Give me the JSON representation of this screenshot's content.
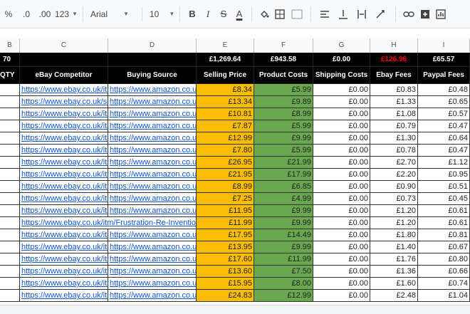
{
  "toolbar": {
    "percent": "%",
    "decrease_decimals": ".0",
    "increase_decimals": ".00",
    "format_more": "123",
    "font": "Arial",
    "font_size": "10",
    "bold": "B",
    "italic": "I",
    "strikethrough": "S",
    "text_color": "A"
  },
  "columns": [
    "B",
    "C",
    "D",
    "E",
    "F",
    "G",
    "H",
    "I"
  ],
  "totals": {
    "b": "70",
    "selling_price": "£1,269.64",
    "product_costs": "£943.58",
    "shipping_costs": "£0.00",
    "ebay_fees": "£126.96",
    "paypal_fees": "£65.57"
  },
  "headers": {
    "b": "QTY",
    "ebay_competitor": "eBay Competitor",
    "buying_source": "Buying Source",
    "selling_price": "Selling Price",
    "product_costs": "Product Costs",
    "shipping_costs": "Shipping Costs",
    "ebay_fees": "Ebay Fees",
    "paypal_fees": "Paypal Fees"
  },
  "colors": {
    "ebay_fees_total": "#ff0000",
    "selling_bg": "#fbbc04",
    "cost_bg": "#6aa84f"
  },
  "rows": [
    {
      "competitor": "https://www.ebay.co.uk/itm",
      "source": "https://www.amazon.co.uk",
      "price": "£8.34",
      "cost": "£5.99",
      "ship": "£0.00",
      "ebay": "£0.83",
      "paypal": "£0.48"
    },
    {
      "competitor": "https://www.ebay.co.uk/sch",
      "source": "https://www.amazon.co.uk",
      "price": "£13.34",
      "cost": "£9.89",
      "ship": "£0.00",
      "ebay": "£1.33",
      "paypal": "£0.65"
    },
    {
      "competitor": "https://www.ebay.co.uk/itm",
      "source": "https://www.amazon.co.uk",
      "price": "£10.81",
      "cost": "£8.99",
      "ship": "£0.00",
      "ebay": "£1.08",
      "paypal": "£0.57"
    },
    {
      "competitor": "https://www.ebay.co.uk/itm",
      "source": "https://www.amazon.co.uk",
      "price": "£7.87",
      "cost": "£5.99",
      "ship": "£0.00",
      "ebay": "£0.79",
      "paypal": "£0.47"
    },
    {
      "competitor": "https://www.ebay.co.uk/itm",
      "source": "https://www.amazon.co.uk",
      "price": "£12.99",
      "cost": "£9.99",
      "ship": "£0.00",
      "ebay": "£1.30",
      "paypal": "£0.64"
    },
    {
      "competitor": "https://www.ebay.co.uk/itm",
      "source": "https://www.amazon.co.uk",
      "price": "£7.80",
      "cost": "£5.99",
      "ship": "£0.00",
      "ebay": "£0.78",
      "paypal": "£0.47"
    },
    {
      "competitor": "https://www.ebay.co.uk/itm",
      "source": "https://www.amazon.co.uk",
      "price": "£26.95",
      "cost": "£21.99",
      "ship": "£0.00",
      "ebay": "£2.70",
      "paypal": "£1.12"
    },
    {
      "competitor": "https://www.ebay.co.uk/itm",
      "source": "https://www.amazon.co.uk",
      "price": "£21.95",
      "cost": "£17.99",
      "ship": "£0.00",
      "ebay": "£2.20",
      "paypal": "£0.95"
    },
    {
      "competitor": "https://www.ebay.co.uk/itm",
      "source": "https://www.amazon.co.uk",
      "price": "£8.99",
      "cost": "£6.85",
      "ship": "£0.00",
      "ebay": "£0.90",
      "paypal": "£0.51"
    },
    {
      "competitor": "https://www.ebay.co.uk/itm",
      "source": "https://www.amazon.co.uk",
      "price": "£7.25",
      "cost": "£4.99",
      "ship": "£0.00",
      "ebay": "£0.73",
      "paypal": "£0.45"
    },
    {
      "competitor": "https://www.ebay.co.uk/itm",
      "source": "https://www.amazon.co.uk",
      "price": "£11.95",
      "cost": "£9.99",
      "ship": "£0.00",
      "ebay": "£1.20",
      "paypal": "£0.61"
    },
    {
      "competitor": "https://www.ebay.co.uk/itm/Frustration-Re-Invention",
      "source": "",
      "price": "£11.99",
      "cost": "£9.99",
      "ship": "£0.00",
      "ebay": "£1.20",
      "paypal": "£0.61"
    },
    {
      "competitor": "https://www.ebay.co.uk/itm",
      "source": "https://www.amazon.co.uk",
      "price": "£17.95",
      "cost": "£14.49",
      "ship": "£0.00",
      "ebay": "£1.80",
      "paypal": "£0.81"
    },
    {
      "competitor": "https://www.ebay.co.uk/itm",
      "source": "https://www.amazon.co.uk",
      "price": "£13.95",
      "cost": "£9.99",
      "ship": "£0.00",
      "ebay": "£1.40",
      "paypal": "£0.67"
    },
    {
      "competitor": "https://www.ebay.co.uk/itm",
      "source": "https://www.amazon.co.uk",
      "price": "£17.60",
      "cost": "£11.99",
      "ship": "£0.00",
      "ebay": "£1.76",
      "paypal": "£0.80"
    },
    {
      "competitor": "https://www.ebay.co.uk/itm",
      "source": "https://www.amazon.co.uk",
      "price": "£13.60",
      "cost": "£7.50",
      "ship": "£0.00",
      "ebay": "£1.36",
      "paypal": "£0.66"
    },
    {
      "competitor": "https://www.ebay.co.uk/itm",
      "source": "https://www.amazon.co.uk",
      "price": "£15.95",
      "cost": "£8.00",
      "ship": "£0.00",
      "ebay": "£1.60",
      "paypal": "£0.74"
    },
    {
      "competitor": "https://www.ebay.co.uk/itm",
      "source": "https://www.amazon.co.uk",
      "price": "£24.83",
      "cost": "£12.99",
      "ship": "£0.00",
      "ebay": "£2.48",
      "paypal": "£1.04"
    }
  ]
}
